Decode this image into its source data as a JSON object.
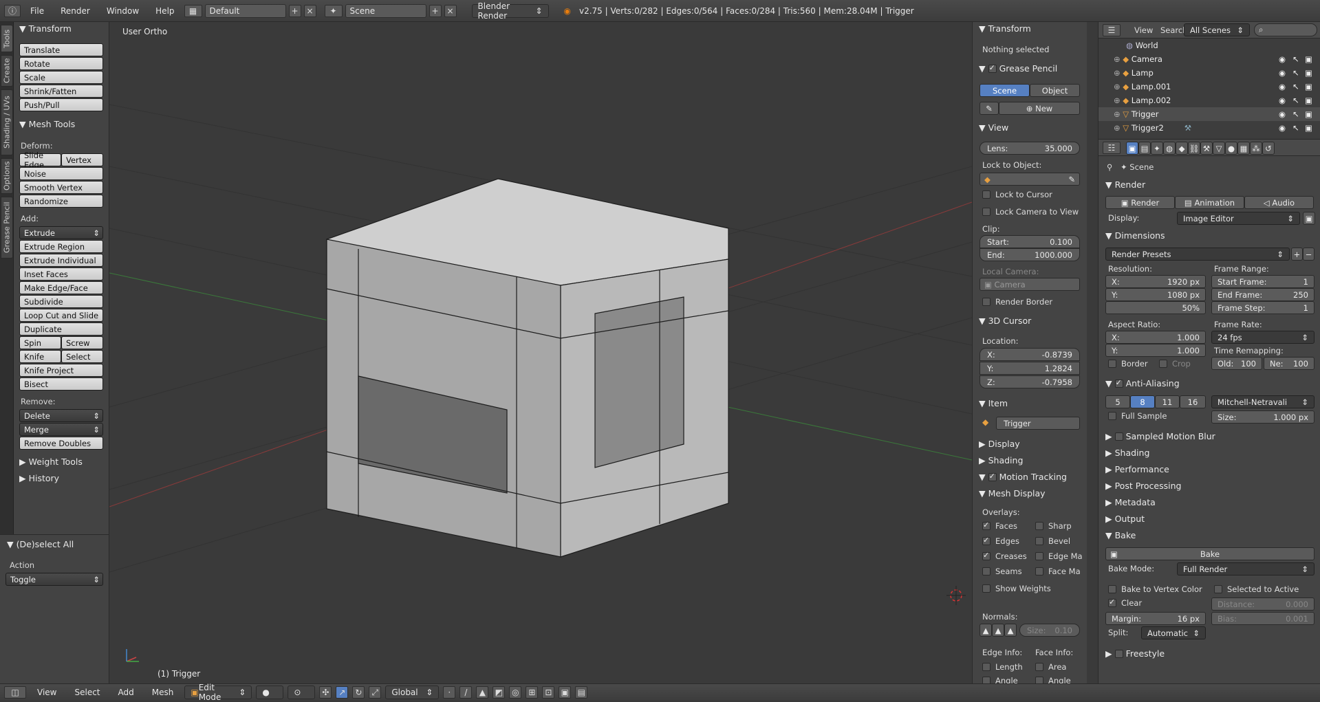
{
  "top": {
    "menus": [
      "File",
      "Render",
      "Window",
      "Help"
    ],
    "layout": "Default",
    "scene": "Scene",
    "engine": "Blender Render",
    "stats": "v2.75 | Verts:0/282 | Edges:0/564 | Faces:0/284 | Tris:560 | Mem:28.04M | Trigger"
  },
  "tabs": [
    "Tools",
    "Create",
    "Shading / UVs",
    "Options",
    "Grease Pencil"
  ],
  "shelf": {
    "transform_title": "Transform",
    "transform": [
      "Translate",
      "Rotate",
      "Scale",
      "Shrink/Fatten",
      "Push/Pull"
    ],
    "meshtools_title": "Mesh Tools",
    "deform_label": "Deform:",
    "slide_edge": "Slide Edge",
    "vertex": "Vertex",
    "noise": "Noise",
    "smooth_vertex": "Smooth Vertex",
    "randomize": "Randomize",
    "add_label": "Add:",
    "extrude": "Extrude",
    "add": [
      "Extrude Region",
      "Extrude Individual",
      "Inset Faces",
      "Make Edge/Face",
      "Subdivide",
      "Loop Cut and Slide",
      "Duplicate"
    ],
    "spin": "Spin",
    "screw": "Screw",
    "knife": "Knife",
    "select": "Select",
    "knife_project": "Knife Project",
    "bisect": "Bisect",
    "remove_label": "Remove:",
    "delete": "Delete",
    "merge": "Merge",
    "remove_doubles": "Remove Doubles",
    "weight_tools": "Weight Tools",
    "history": "History"
  },
  "redo": {
    "title": "(De)select All",
    "action_label": "Action",
    "action": "Toggle"
  },
  "viewport": {
    "view_name": "User Ortho",
    "object": "(1) Trigger"
  },
  "npanel": {
    "transform": "Transform",
    "nothing_selected": "Nothing selected",
    "grease_pencil": "Grease Pencil",
    "scene_btn": "Scene",
    "object_btn": "Object",
    "new_btn": "New",
    "view": "View",
    "lens_label": "Lens:",
    "lens": "35.000",
    "lock_to_object": "Lock to Object:",
    "lock_to_cursor": "Lock to Cursor",
    "lock_camera": "Lock Camera to View",
    "clip": "Clip:",
    "start_label": "Start:",
    "start": "0.100",
    "end_label": "End:",
    "end": "1000.000",
    "local_camera": "Local Camera:",
    "camera": "Camera",
    "render_border": "Render Border",
    "cursor": "3D Cursor",
    "location": "Location:",
    "x_label": "X:",
    "x": "-0.8739",
    "y_label": "Y:",
    "y": "1.2824",
    "z_label": "Z:",
    "z": "-0.7958",
    "item": "Item",
    "item_name": "Trigger",
    "display": "Display",
    "shading": "Shading",
    "motion_tracking": "Motion Tracking",
    "mesh_display": "Mesh Display",
    "overlays": "Overlays:",
    "faces": "Faces",
    "sharp": "Sharp",
    "edges": "Edges",
    "bevel": "Bevel",
    "creases": "Creases",
    "edge_ma": "Edge Ma",
    "seams": "Seams",
    "face_ma": "Face Ma",
    "show_weights": "Show Weights",
    "normals": "Normals:",
    "size_label": "Size:",
    "size": "0.10",
    "edge_info": "Edge Info:",
    "face_info": "Face Info:",
    "length": "Length",
    "area": "Area",
    "angle1": "Angle",
    "angle2": "Angle"
  },
  "outliner": {
    "view": "View",
    "search": "Search",
    "scenes": "All Scenes",
    "items": [
      "World",
      "Camera",
      "Lamp",
      "Lamp.001",
      "Lamp.002",
      "Trigger",
      "Trigger2"
    ]
  },
  "props": {
    "scene": "Scene",
    "render": "Render",
    "render_btn": "Render",
    "animation_btn": "Animation",
    "audio_btn": "Audio",
    "display_label": "Display:",
    "display": "Image Editor",
    "dimensions": "Dimensions",
    "presets": "Render Presets",
    "resolution": "Resolution:",
    "res_x_label": "X:",
    "res_x": "1920 px",
    "res_y_label": "Y:",
    "res_y": "1080 px",
    "res_pct": "50%",
    "frame_range": "Frame Range:",
    "start_frame_label": "Start Frame:",
    "start_frame": "1",
    "end_frame_label": "End Frame:",
    "end_frame": "250",
    "frame_step_label": "Frame Step:",
    "frame_step": "1",
    "aspect": "Aspect Ratio:",
    "asp_x_label": "X:",
    "asp_x": "1.000",
    "asp_y_label": "Y:",
    "asp_y": "1.000",
    "frame_rate": "Frame Rate:",
    "fps": "24 fps",
    "time_remap": "Time Remapping:",
    "old_label": "Old:",
    "old": "100",
    "new_label": "Ne:",
    "new": "100",
    "border": "Border",
    "crop": "Crop",
    "aa": "Anti-Aliasing",
    "aa5": "5",
    "aa8": "8",
    "aa11": "11",
    "aa16": "16",
    "filter": "Mitchell-Netravali",
    "full_sample": "Full Sample",
    "size_label": "Size:",
    "size": "1.000 px",
    "sampled_motion_blur": "Sampled Motion Blur",
    "shading": "Shading",
    "performance": "Performance",
    "post_processing": "Post Processing",
    "metadata": "Metadata",
    "output": "Output",
    "bake": "Bake",
    "bake_btn": "Bake",
    "bake_mode_label": "Bake Mode:",
    "bake_mode": "Full Render",
    "bake_vcol": "Bake to Vertex Color",
    "sel_active": "Selected to Active",
    "clear": "Clear",
    "distance_label": "Distance:",
    "distance": "0.000",
    "margin_label": "Margin:",
    "margin": "16 px",
    "bias_label": "Bias:",
    "bias": "0.001",
    "split_label": "Split:",
    "split": "Automatic",
    "freestyle": "Freestyle"
  },
  "bottom": {
    "view": "View",
    "select": "Select",
    "add": "Add",
    "mesh": "Mesh",
    "mode": "Edit Mode",
    "orientation": "Global"
  }
}
